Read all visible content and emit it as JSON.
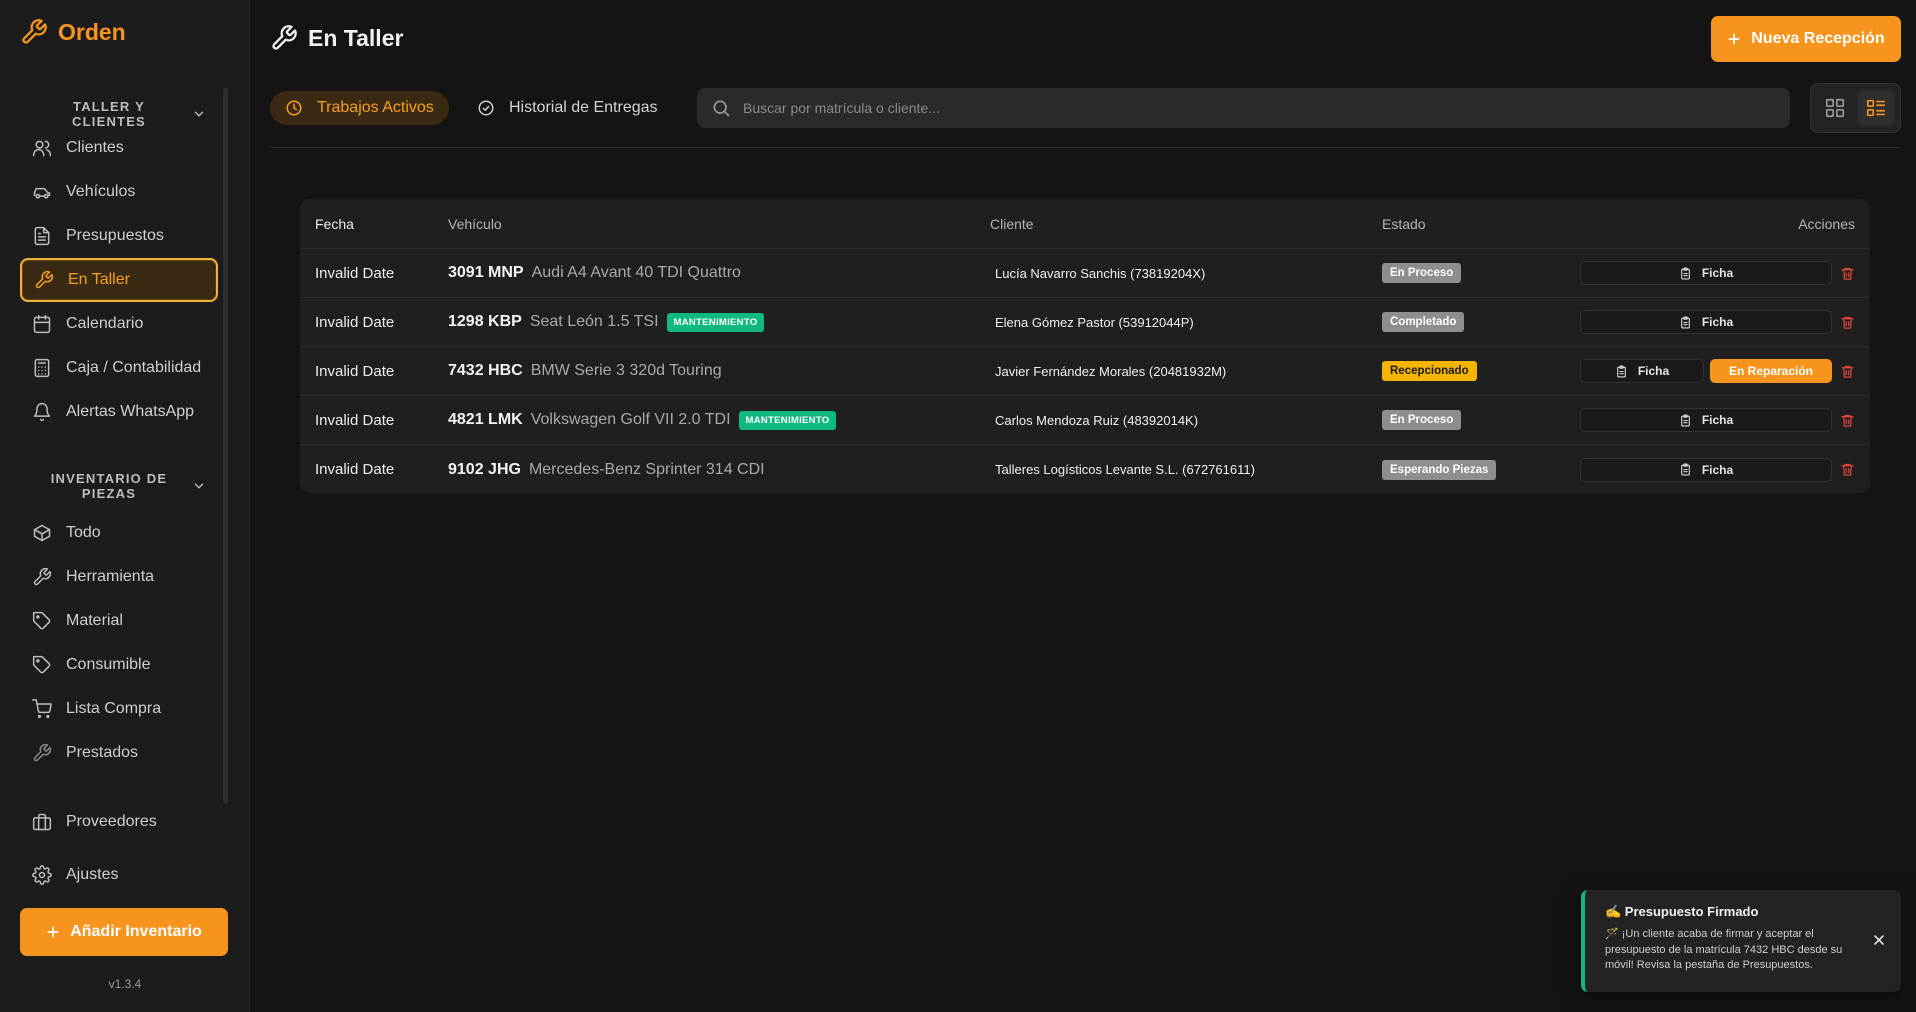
{
  "brand": {
    "name": "Orden"
  },
  "sidebar": {
    "section1": "TALLER Y CLIENTES",
    "section2": "INVENTARIO DE PIEZAS",
    "items": [
      {
        "label": "Clientes",
        "icon": "users-icon"
      },
      {
        "label": "Vehículos",
        "icon": "car-icon"
      },
      {
        "label": "Presupuestos",
        "icon": "document-icon"
      },
      {
        "label": "En Taller",
        "icon": "wrench-icon",
        "active": true
      },
      {
        "label": "Calendario",
        "icon": "calendar-icon"
      },
      {
        "label": "Caja / Contabilidad",
        "icon": "calculator-icon"
      },
      {
        "label": "Alertas WhatsApp",
        "icon": "bell-icon"
      }
    ],
    "inventory": [
      {
        "label": "Todo",
        "icon": "box-icon"
      },
      {
        "label": "Herramienta",
        "icon": "wrench-icon"
      },
      {
        "label": "Material",
        "icon": "tag-icon"
      },
      {
        "label": "Consumible",
        "icon": "tag-icon"
      },
      {
        "label": "Lista Compra",
        "icon": "cart-icon"
      },
      {
        "label": "Prestados",
        "icon": "wrench-icon"
      }
    ],
    "bottom": [
      {
        "label": "Proveedores",
        "icon": "briefcase-icon"
      },
      {
        "label": "Ajustes",
        "icon": "gear-icon"
      }
    ],
    "add_button": "Añadir Inventario",
    "version": "v1.3.4"
  },
  "header": {
    "title": "En Taller",
    "new_button": "Nueva Recepción",
    "tabs": [
      {
        "label": "Trabajos Activos",
        "active": true
      },
      {
        "label": "Historial de Entregas",
        "active": false
      }
    ],
    "search_placeholder": "Buscar por matrícula o cliente..."
  },
  "table": {
    "columns": {
      "fecha": "Fecha",
      "vehiculo": "Vehículo",
      "cliente": "Cliente",
      "estado": "Estado",
      "acciones": "Acciones"
    },
    "rows": [
      {
        "date": "Invalid Date",
        "plate": "3091 MNP",
        "model": "Audi A4 Avant 40 TDI Quattro",
        "tag": "",
        "client": "Lucía Navarro Sanchis (73819204X)",
        "status": "En Proceso",
        "status_color": "#8e8e8e",
        "ficha": "Ficha",
        "repair": ""
      },
      {
        "date": "Invalid Date",
        "plate": "1298 KBP",
        "model": "Seat León 1.5 TSI",
        "tag": "MANTENIMIENTO",
        "client": "Elena Gómez Pastor (53912044P)",
        "status": "Completado",
        "status_color": "#8e8e8e",
        "ficha": "Ficha",
        "repair": ""
      },
      {
        "date": "Invalid Date",
        "plate": "7432 HBC",
        "model": "BMW Serie 3 320d Touring",
        "tag": "",
        "client": "Javier Fernández Morales (20481932M)",
        "status": "Recepcionado",
        "status_color": "#f5b400",
        "ficha": "Ficha",
        "repair": "En Reparación"
      },
      {
        "date": "Invalid Date",
        "plate": "4821 LMK",
        "model": "Volkswagen Golf VII 2.0 TDI",
        "tag": "MANTENIMIENTO",
        "client": "Carlos Mendoza Ruiz (48392014K)",
        "status": "En Proceso",
        "status_color": "#8e8e8e",
        "ficha": "Ficha",
        "repair": ""
      },
      {
        "date": "Invalid Date",
        "plate": "9102 JHG",
        "model": "Mercedes-Benz Sprinter 314 CDI",
        "tag": "",
        "client": "Talleres Logísticos Levante S.L. (672761611)",
        "status": "Esperando Piezas",
        "status_color": "#8e8e8e",
        "ficha": "Ficha",
        "repair": ""
      }
    ]
  },
  "toast": {
    "title": "✍️ Presupuesto Firmado",
    "message": "🪄 ¡Un cliente acaba de firmar y aceptar el presupuesto de la matrícula 7432 HBC desde su móvil! Revisa la pestaña de Presupuestos."
  },
  "colors": {
    "accent": "#f7941d",
    "success": "#10b981",
    "danger": "#e0453a"
  }
}
